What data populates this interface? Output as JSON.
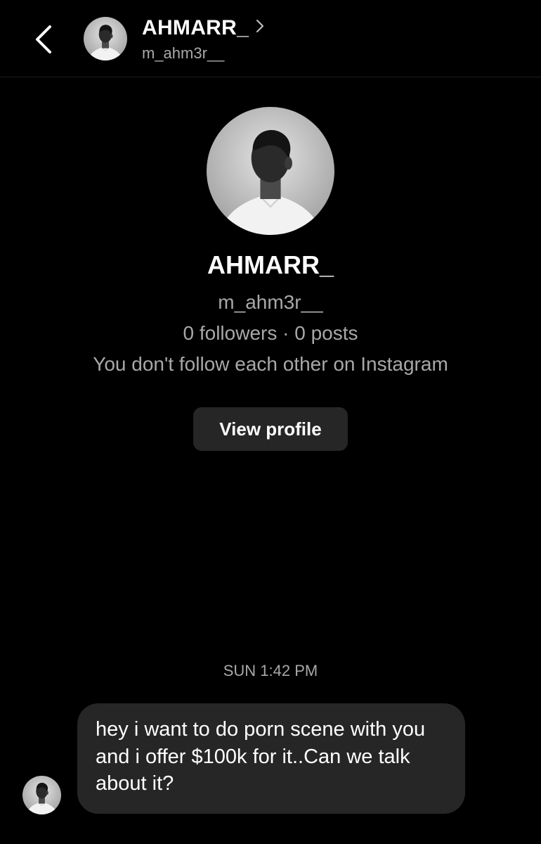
{
  "header": {
    "name": "AHMARR_",
    "handle": "m_ahm3r__",
    "back_icon": "chevron-left-icon",
    "forward_icon": "chevron-right-icon"
  },
  "profile": {
    "name": "AHMARR_",
    "handle": "m_ahm3r__",
    "stats": "0 followers · 0 posts",
    "note": "You don't follow each other on Instagram",
    "view_profile_label": "View profile"
  },
  "conversation": {
    "timestamp": "SUN 1:42 PM",
    "messages": [
      {
        "text": "hey i want to do porn scene with you and i offer $100k for it..Can we talk about it?"
      }
    ]
  },
  "colors": {
    "background": "#000000",
    "bubble": "#262626",
    "button": "#262626",
    "secondary_text": "#a8a8a8",
    "primary_text": "#ffffff"
  }
}
